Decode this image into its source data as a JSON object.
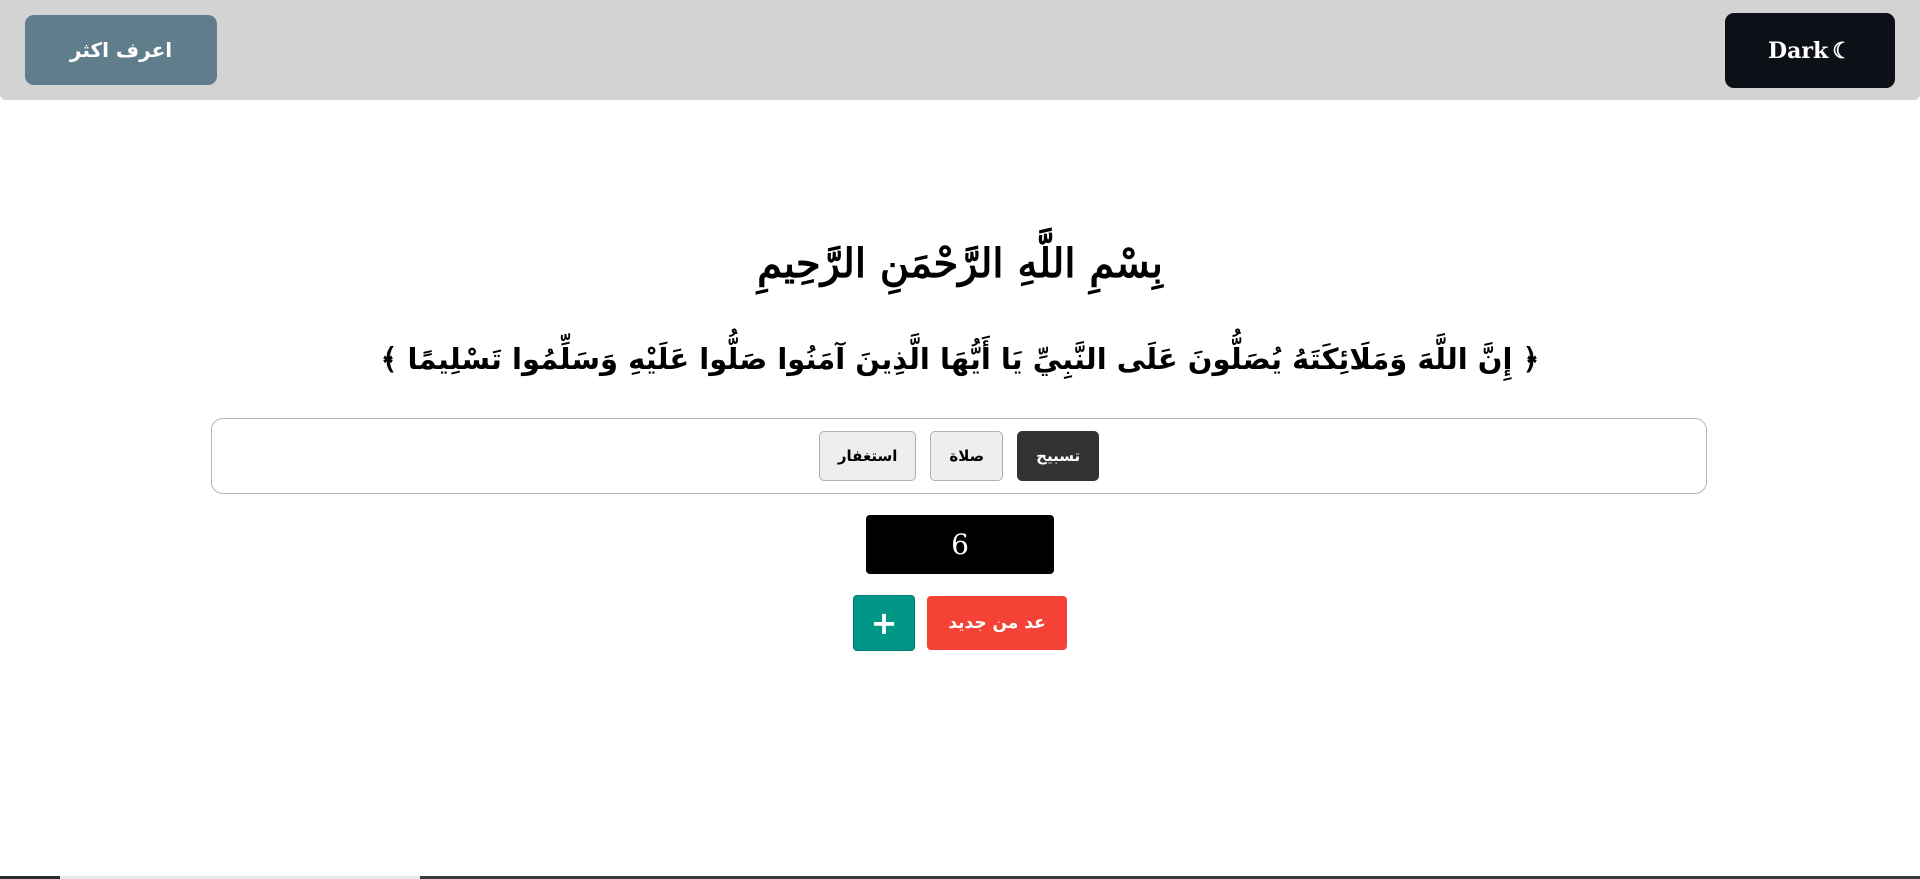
{
  "header": {
    "learn_more_label": "اعرف اكثر",
    "dark_mode_label": "Dark",
    "dark_mode_icon": "☾"
  },
  "main": {
    "basmala": "بِسْمِ اللَّهِ الرَّحْمَنِ الرَّحِيمِ",
    "verse": "﴿ إِنَّ اللَّهَ وَمَلَائِكَتَهُ يُصَلُّونَ عَلَى النَّبِيِّ يَا أَيُّهَا الَّذِينَ آمَنُوا صَلُّوا عَلَيْهِ وَسَلِّمُوا تَسْلِيمًا ﴾"
  },
  "tabs": [
    {
      "label": "تسبيح",
      "active": true
    },
    {
      "label": "صلاة",
      "active": false
    },
    {
      "label": "استغفار",
      "active": false
    }
  ],
  "counter": {
    "value": "6"
  },
  "actions": {
    "increment_label": "+",
    "reset_label": "عد من جديد"
  },
  "colors": {
    "header_bg": "#d3d3d3",
    "learn_more_bg": "#607d8b",
    "dark_button_bg": "#0d1117",
    "active_tab_bg": "#333333",
    "counter_bg": "#000000",
    "increment_bg": "#009688",
    "reset_bg": "#f44336"
  }
}
